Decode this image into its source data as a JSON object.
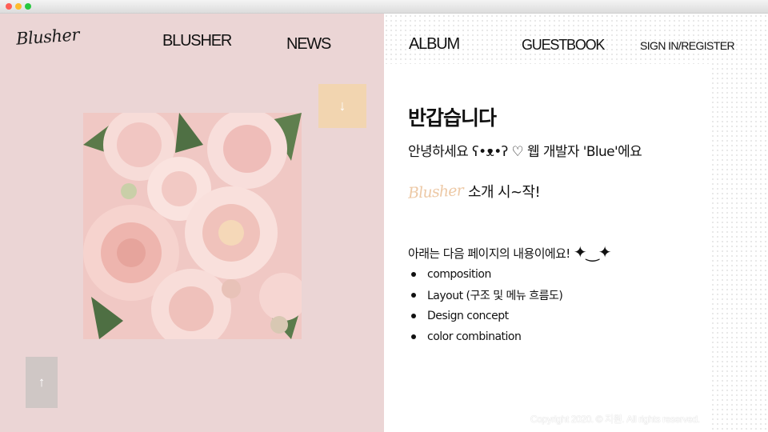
{
  "window": {
    "controls": [
      "close",
      "minimize",
      "maximize"
    ]
  },
  "header": {
    "logo": "Blusher",
    "nav": {
      "blusher": "BLUSHER",
      "news": "NEWS",
      "album": "ALBUM",
      "guestbook": "GUESTBOOK",
      "signin": "SIGN IN/REGISTER"
    }
  },
  "controls": {
    "scroll_down_icon": "↓",
    "scroll_up_icon": "↑"
  },
  "hero": {
    "image": "pink-peony-bouquet-photo"
  },
  "intro": {
    "heading": "반갑습니다",
    "greeting": "안녕하세요 ʕ•ᴥ•ʔ ♡ 웹 개발자 'Blue'에요",
    "brand": "Blusher",
    "start_text": "소개 시~작!",
    "pages_intro": "아래는 다음 페이지의 내용이에요!",
    "sparkles": "✦‿✦",
    "topics": [
      "composition",
      "Layout (구조 및 메뉴 흐름도)",
      "Design concept",
      "color combination"
    ]
  },
  "footer": {
    "copyright": "Copyright 2020. © 지원. All rights reserved."
  },
  "colors": {
    "left_panel": "#ebd5d5",
    "scroll_down_button": "#f2d5b0",
    "scroll_up_button": "#cfc7c5",
    "brand_accent": "#edc9a6",
    "text": "#111111"
  }
}
